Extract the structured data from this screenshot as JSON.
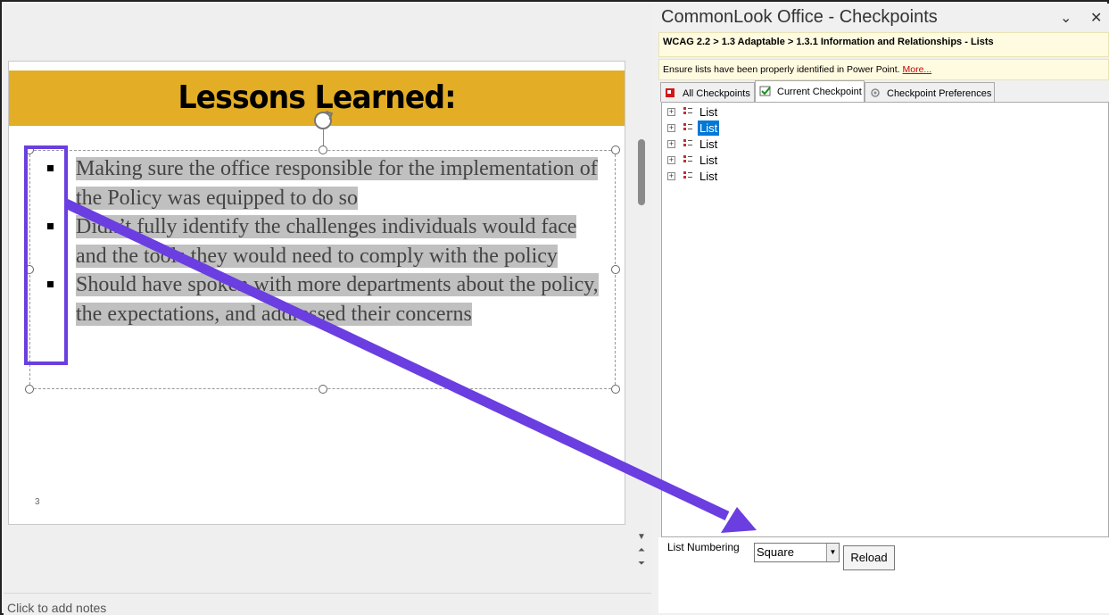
{
  "slide": {
    "title": "Lessons Learned:",
    "bullets": [
      "Making sure the office responsible for the implementation of the Policy was equipped to do so",
      "Didn’t fully identify the challenges individuals would face and the tools they would need to comply with the policy",
      "Should have spoken with more departments about the policy, the expectations, and addressed their concerns"
    ],
    "slide_number": "3"
  },
  "notes": {
    "placeholder": "Click to add notes"
  },
  "pane": {
    "title": "CommonLook Office - Checkpoints",
    "breadcrumb": "WCAG 2.2 > 1.3 Adaptable > 1.3.1 Information and Relationships - Lists",
    "hint": "Ensure lists have been properly identified in Power Point.",
    "hint_link": "More...",
    "tabs": [
      "All Checkpoints",
      "Current Checkpoint",
      "Checkpoint Preferences"
    ],
    "tree_items": [
      {
        "label": "List",
        "selected": false
      },
      {
        "label": "List",
        "selected": true
      },
      {
        "label": "List",
        "selected": false
      },
      {
        "label": "List",
        "selected": false
      },
      {
        "label": "List",
        "selected": false
      }
    ],
    "list_numbering_label": "List Numbering",
    "list_numbering_value": "Square",
    "reload_label": "Reload"
  },
  "colors": {
    "title_bar": "#e3ae25",
    "annotation": "#6a3ee0",
    "selection": "#0078d7",
    "link": "#cc0000"
  }
}
